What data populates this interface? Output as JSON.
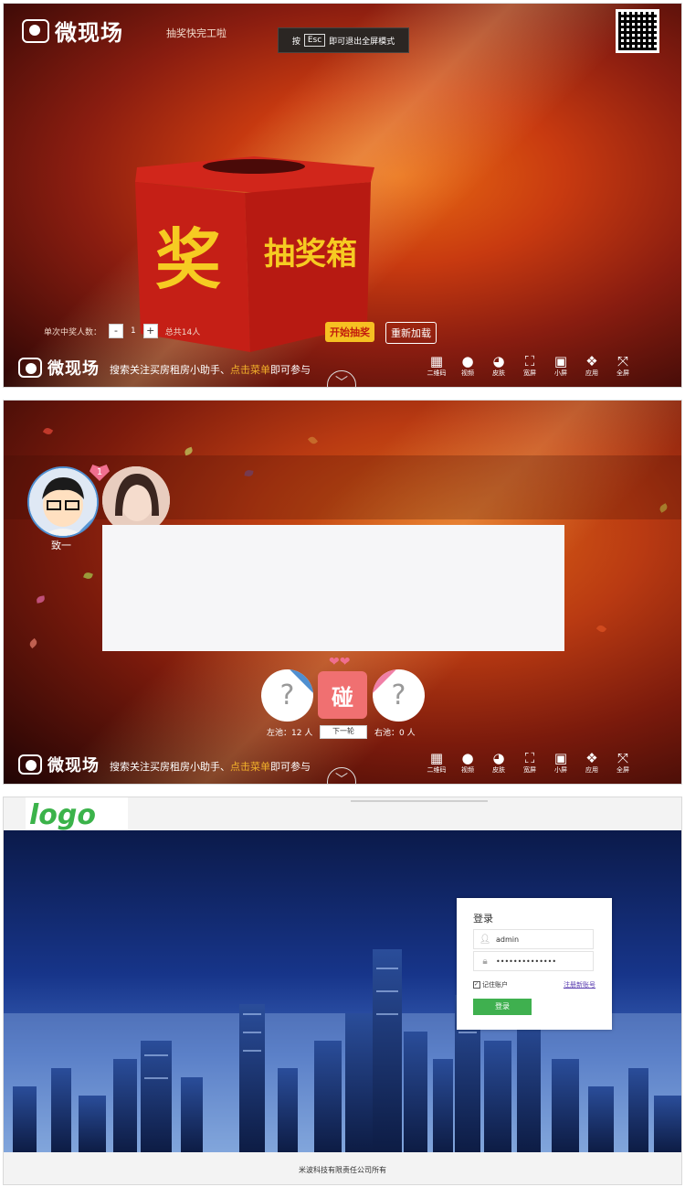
{
  "screen1": {
    "brand_name": "微现场",
    "top_caption": "抽奖快完工啦",
    "esc_hint": {
      "prefix": "按",
      "key": "Esc",
      "suffix": "即可退出全屏模式"
    },
    "box_glyph": "奖",
    "box_title": "抽奖箱",
    "winners_label": "单次中奖人数：",
    "minus": "-",
    "winners_value": "1",
    "plus": "+",
    "total_label": "总共14人",
    "start_button": "开始抽奖",
    "reload_button": "重新加载",
    "footer_slogan_pre": "搜索关注买房租房小助手、",
    "footer_slogan_hl": "点击菜单",
    "footer_slogan_post": "即可参与",
    "tools": [
      {
        "icon": "qr-icon",
        "glyph": "▦",
        "label": "二维码"
      },
      {
        "icon": "video-icon",
        "glyph": "●",
        "label": "视频"
      },
      {
        "icon": "palette-icon",
        "glyph": "◕",
        "label": "皮肤"
      },
      {
        "icon": "maximize-icon",
        "glyph": "⛶",
        "label": "宽屏"
      },
      {
        "icon": "minimize-icon",
        "glyph": "▣",
        "label": "小屏"
      },
      {
        "icon": "apps-icon",
        "glyph": "❖",
        "label": "应用"
      },
      {
        "icon": "fullscreen-icon",
        "glyph": "⤧",
        "label": "全屏"
      }
    ],
    "collapse_icon": "chevron-down-icon",
    "collapse_glyph": "﹀"
  },
  "screen2": {
    "badge_count": "1",
    "person_name": "致一",
    "question_mark": "?",
    "bump_label": "碰",
    "left_pool": "左池：12 人",
    "next_button": "下一轮",
    "right_pool": "右池：0 人",
    "male_icon": "male-icon",
    "female_icon": "female-icon",
    "heart_icon": "heart-icon"
  },
  "screen3": {
    "logo": "logo",
    "login_title": "登录",
    "username": "admin",
    "password": "••••••••••••••",
    "remember_label": "记住账户",
    "register_link": "注册新账号",
    "login_button": "登录",
    "copyright": "米波科技有限责任公司所有",
    "colors": {
      "accent": "#3fb04f",
      "link": "#5a3db0"
    }
  }
}
